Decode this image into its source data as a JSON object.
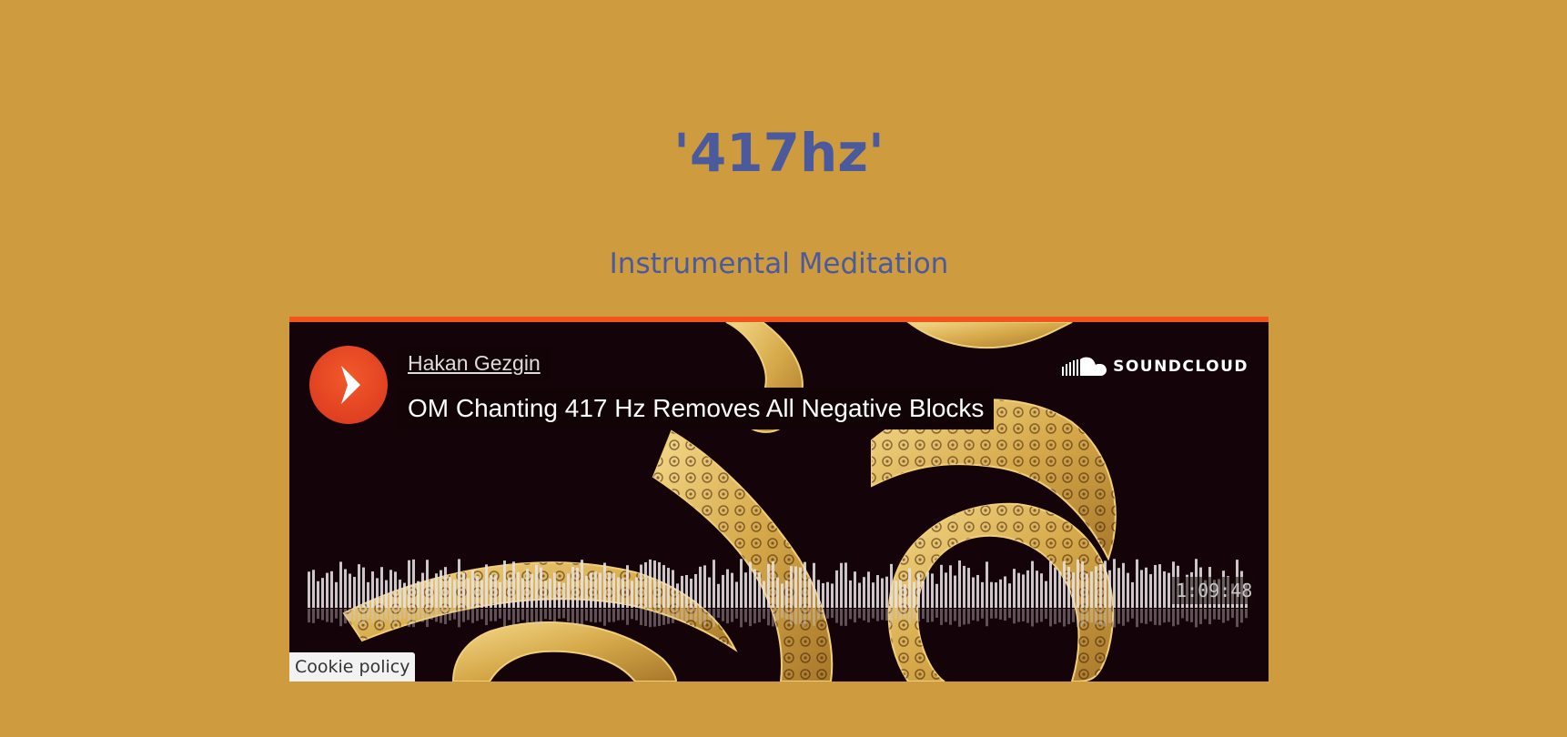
{
  "page": {
    "title": "'417hz'",
    "subtitle": "Instrumental Meditation",
    "background_color": "#ce9c3f",
    "text_color": "#4a5a9c"
  },
  "player": {
    "accent_color": "#f2541b",
    "artist": "Hakan Gezgin",
    "track_title": "OM Chanting 417 Hz Removes All Negative Blocks",
    "brand": "SOUNDCLOUD",
    "brand_icon": "soundcloud-logo-icon",
    "play_icon": "play-icon",
    "duration": "1:09:48",
    "progress": 0,
    "cookie_label": "Cookie policy"
  }
}
